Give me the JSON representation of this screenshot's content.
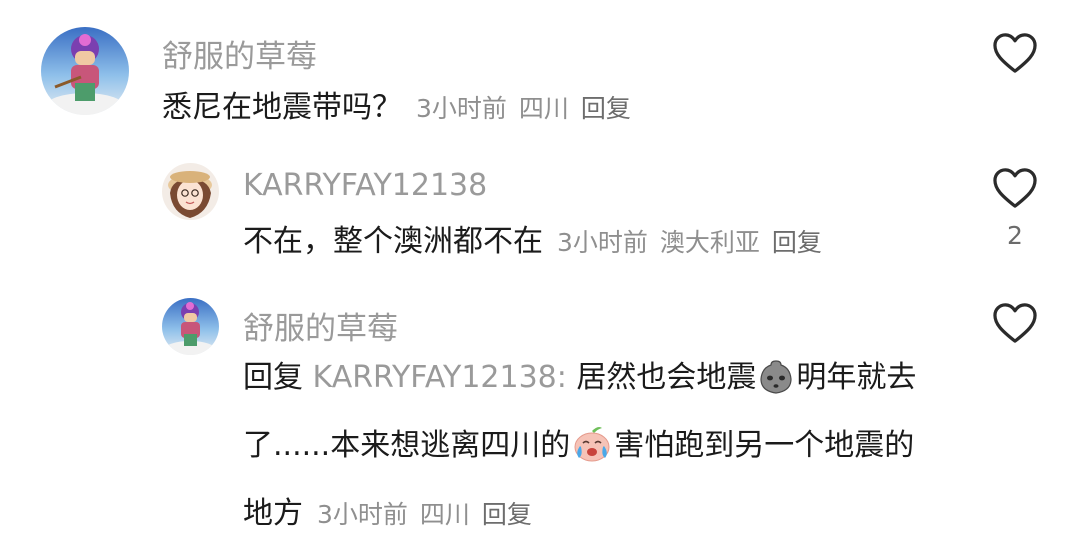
{
  "comments": [
    {
      "username": "舒服的草莓",
      "text": "悉尼在地震带吗？",
      "time": "3小时前",
      "location": "四川",
      "reply_label": "回复",
      "like_icon": "heart-outline-icon",
      "like_count": ""
    },
    {
      "username": "KARRYFAY12138",
      "text": "不在，整个澳洲都不在",
      "time": "3小时前",
      "location": "澳大利亚",
      "reply_label": "回复",
      "like_icon": "heart-outline-icon",
      "like_count": "2"
    },
    {
      "username": "舒服的草莓",
      "reply_prefix": "回复",
      "reply_to": "KARRYFAY12138:",
      "text_part1": "居然也会地震",
      "emoji1": "grey-stone-face-emoji",
      "text_part2": "明年就去了......本来想逃离四川的",
      "emoji2": "crying-peach-emoji",
      "text_part3": "害怕跑到另一个地震的地方",
      "time": "3小时前",
      "location": "四川",
      "reply_label": "回复",
      "like_icon": "heart-outline-icon",
      "like_count": ""
    }
  ],
  "colors": {
    "username": "#9a9a9a",
    "text": "#1b1b1b",
    "meta": "#8f8f8f",
    "icon": "#2b2b2b"
  }
}
